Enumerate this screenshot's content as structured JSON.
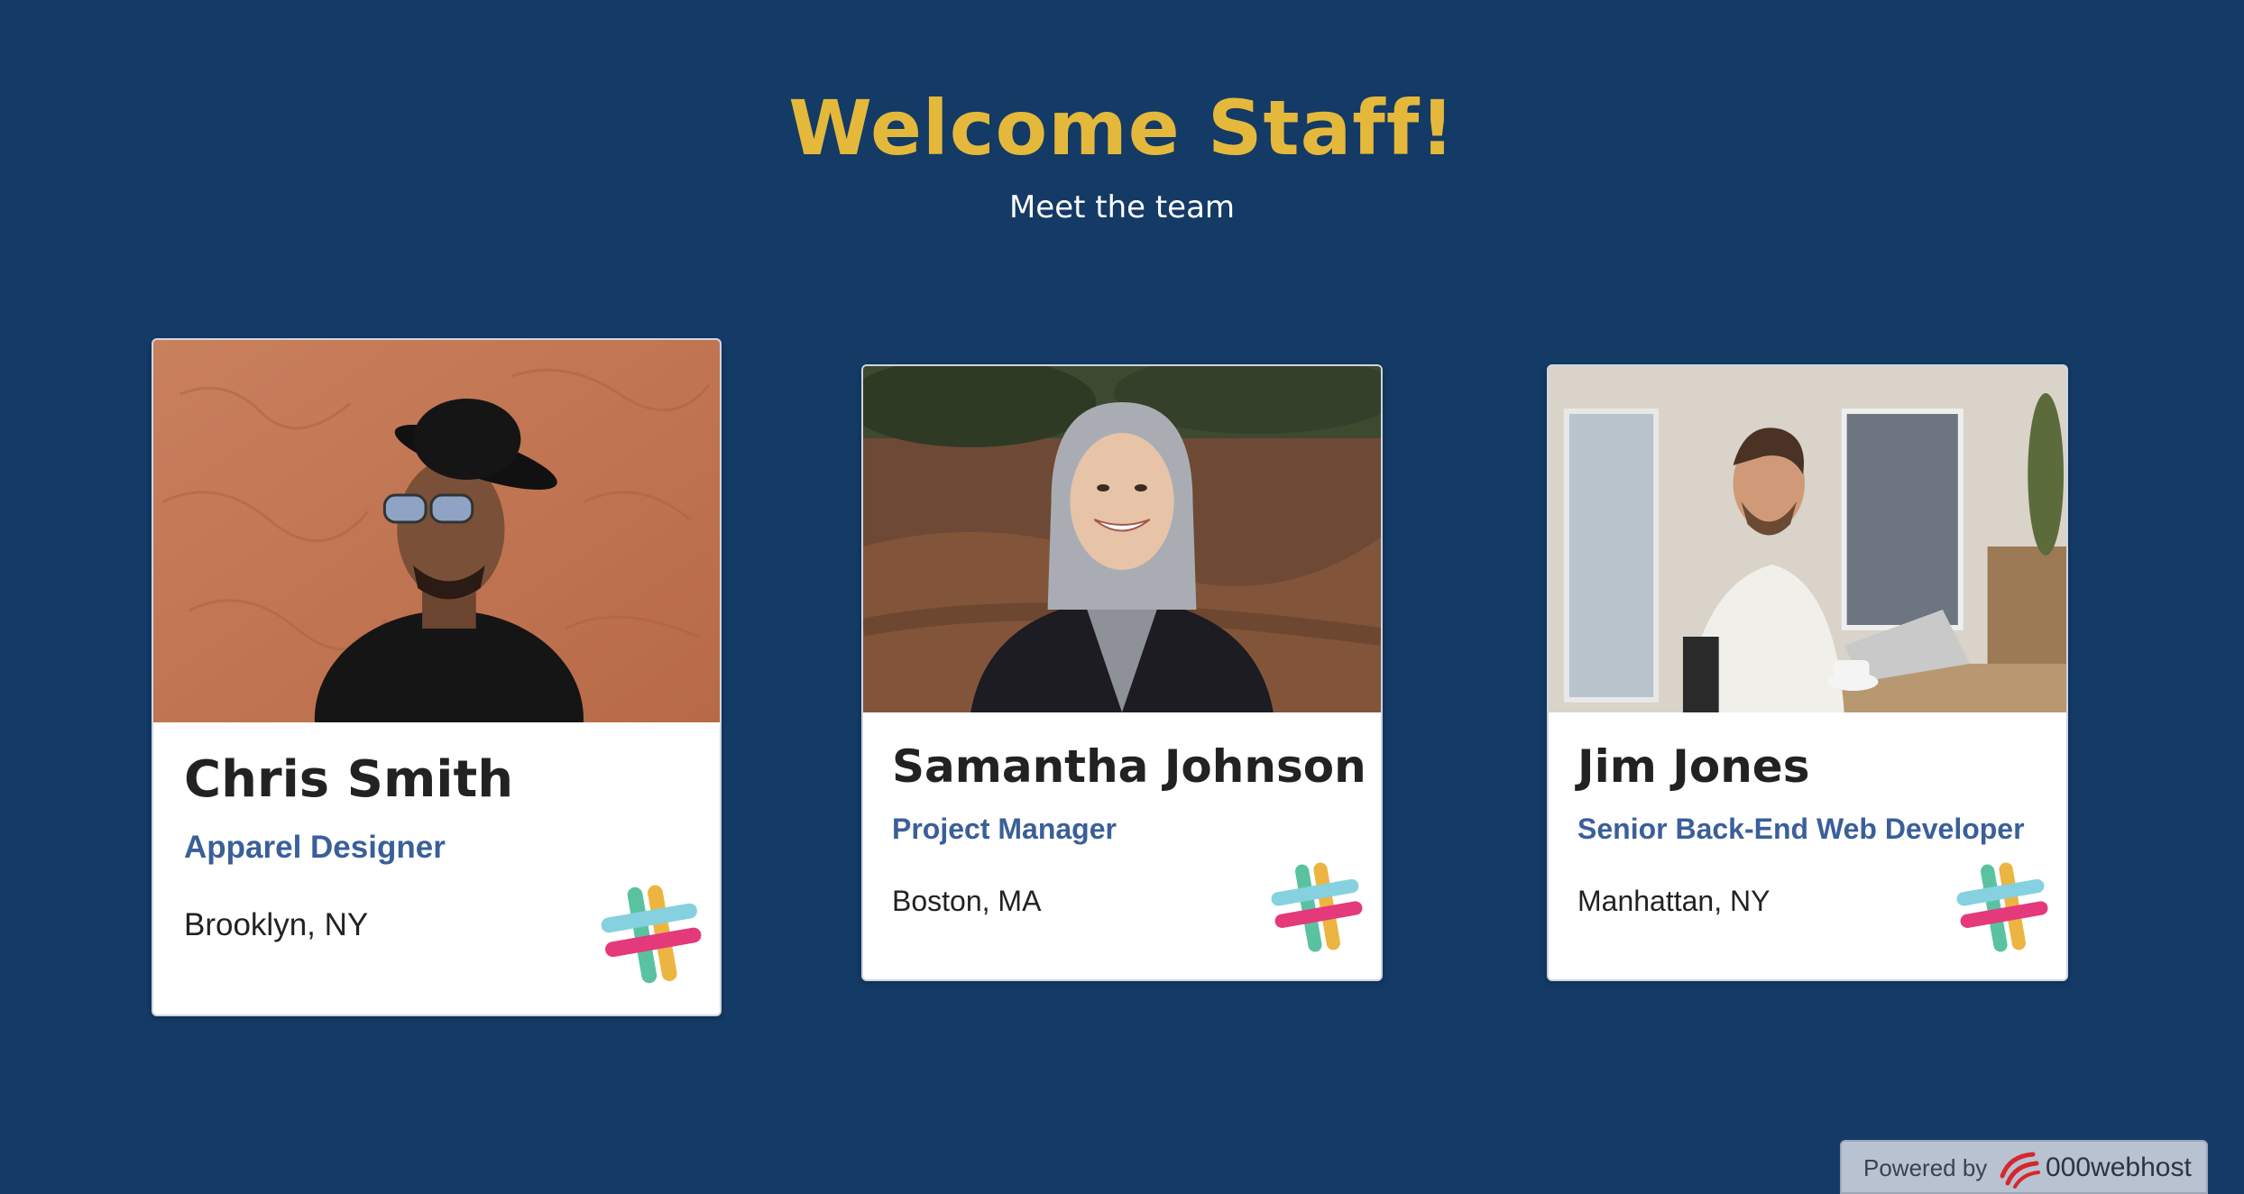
{
  "header": {
    "title": "Welcome Staff!",
    "subtitle": "Meet the team"
  },
  "team": [
    {
      "name": "Chris Smith",
      "role": "Apparel Designer",
      "location": "Brooklyn, NY",
      "photo_icon": "person-photo",
      "contact_icon": "slack-icon"
    },
    {
      "name": "Samantha Johnson",
      "role": "Project Manager",
      "location": "Boston, MA",
      "photo_icon": "person-photo",
      "contact_icon": "slack-icon"
    },
    {
      "name": "Jim Jones",
      "role": "Senior Back-End Web Developer",
      "location": "Manhattan, NY",
      "photo_icon": "person-photo",
      "contact_icon": "slack-icon"
    }
  ],
  "footer_badge": {
    "label": "Powered by",
    "brand": "000webhost",
    "logo_icon": "webhost-logo-icon"
  },
  "colors": {
    "background": "#143a66",
    "title": "#e4b93b",
    "role": "#3a5f99",
    "card": "#ffffff"
  }
}
